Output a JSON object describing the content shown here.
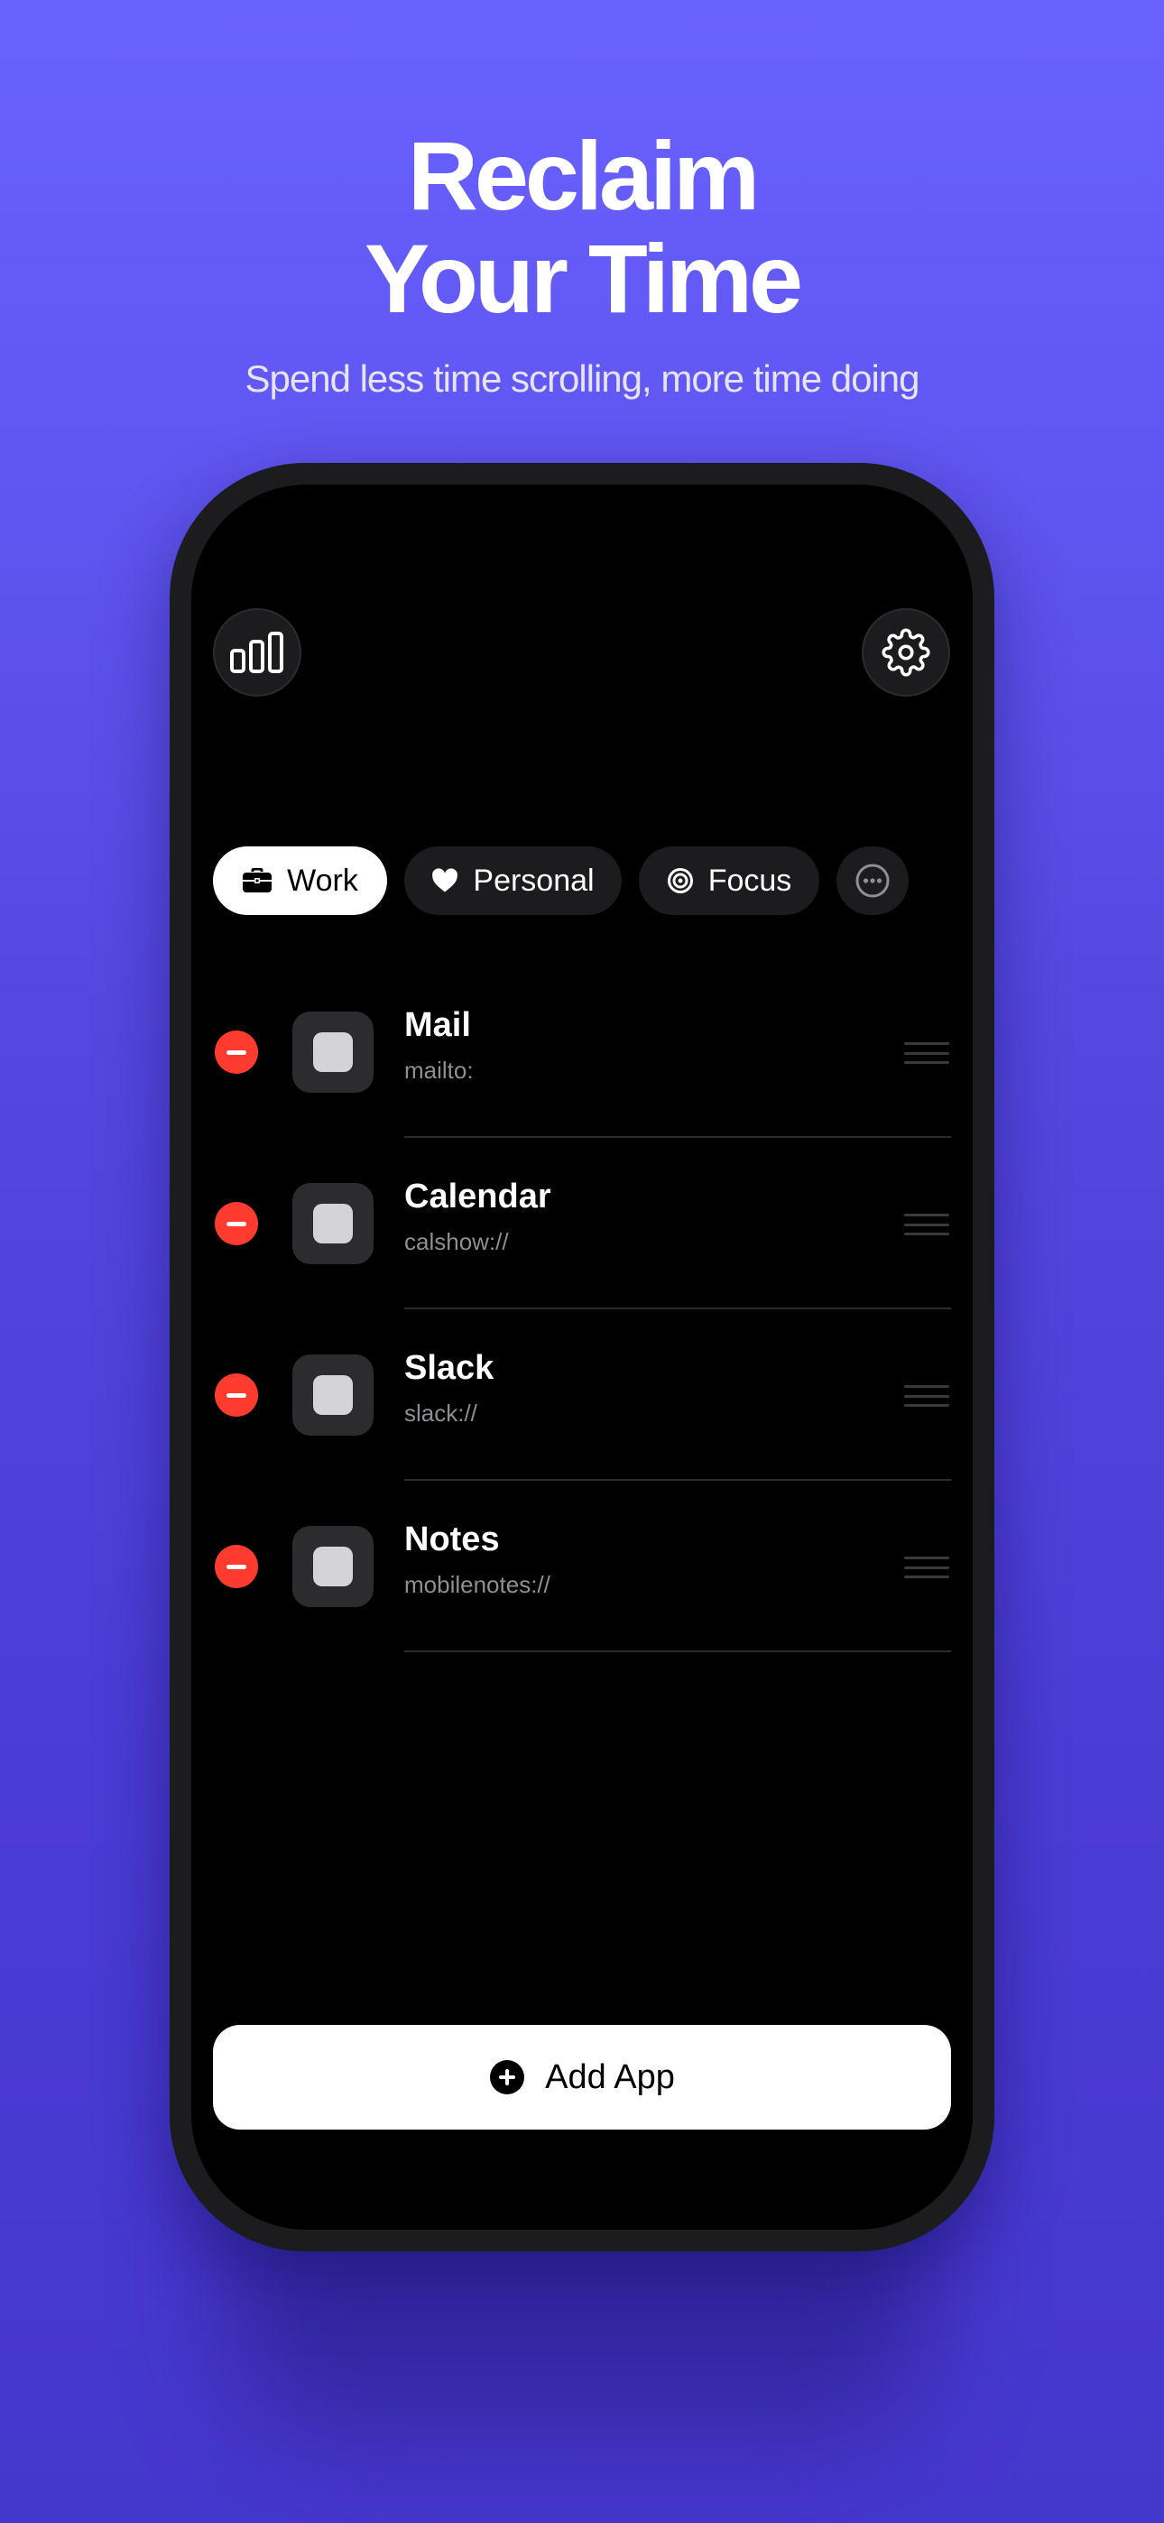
{
  "hero": {
    "title_line1": "Reclaim",
    "title_line2": "Your Time",
    "subtitle": "Spend less time scrolling, more time doing"
  },
  "header": {
    "stats_icon": "bar-chart-icon",
    "settings_icon": "gear-icon"
  },
  "tabs": [
    {
      "label": "Work",
      "icon": "briefcase-icon",
      "selected": true
    },
    {
      "label": "Personal",
      "icon": "heart-icon",
      "selected": false
    },
    {
      "label": "Focus",
      "icon": "target-icon",
      "selected": false
    },
    {
      "label": "",
      "icon": "ellipsis-circle-icon",
      "selected": false
    }
  ],
  "apps": [
    {
      "name": "Mail",
      "url": "mailto:"
    },
    {
      "name": "Calendar",
      "url": "calshow://"
    },
    {
      "name": "Slack",
      "url": "slack://"
    },
    {
      "name": "Notes",
      "url": "mobilenotes://"
    }
  ],
  "add_button": {
    "label": "Add App",
    "icon": "plus-circle-icon"
  },
  "colors": {
    "background_top": "#6a62ff",
    "background_bottom": "#4437cc",
    "remove": "#ff3b30",
    "screen": "#000000",
    "pill": "#1c1c1e"
  }
}
